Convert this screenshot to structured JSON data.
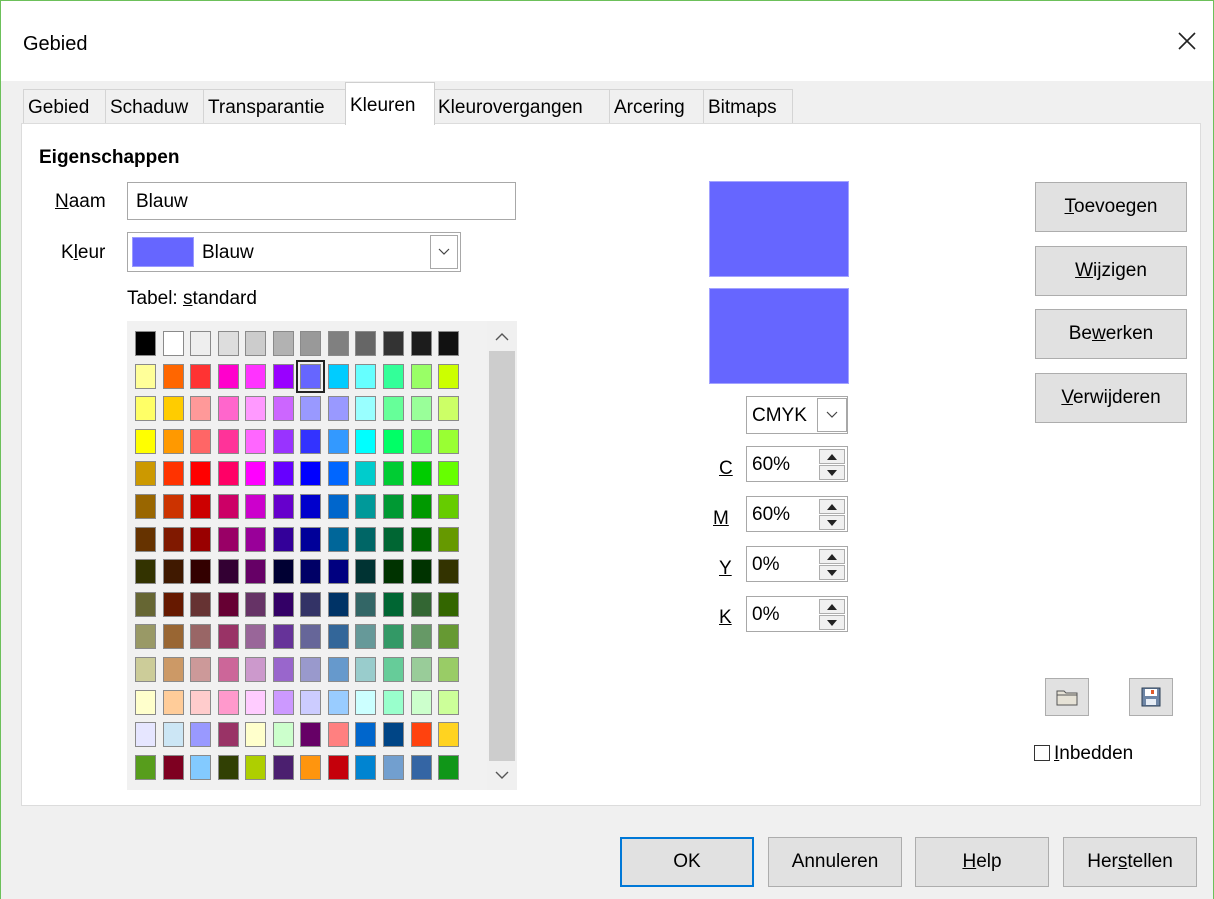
{
  "window": {
    "title": "Gebied"
  },
  "tabs": [
    {
      "label": "Gebied",
      "active": false
    },
    {
      "label": "Schaduw",
      "active": false
    },
    {
      "label": "Transparantie",
      "active": false
    },
    {
      "label": "Kleuren",
      "active": true
    },
    {
      "label": "Kleurovergangen",
      "active": false
    },
    {
      "label": "Arcering",
      "active": false
    },
    {
      "label": "Bitmaps",
      "active": false
    }
  ],
  "properties": {
    "heading": "Eigenschappen",
    "name_label_u": "N",
    "name_label_rest": "aam",
    "name_value": "Blauw",
    "color_label_pre": "K",
    "color_label_u": "l",
    "color_label_post": "eur",
    "color_value": "Blauw",
    "table_label_pre": "Tabel: ",
    "table_label_u": "s",
    "table_label_post": "tandard"
  },
  "palette": {
    "selected": "#6666ff",
    "rows": [
      [
        "#000000",
        "#ffffff",
        "#eeeeee",
        "#dddddd",
        "#cccccc",
        "#b2b2b2",
        "#999999",
        "#808080",
        "#666666",
        "#333333",
        "#1c1c1c",
        "#111111"
      ],
      [
        "#ffff99",
        "#ff6600",
        "#ff3333",
        "#ff00cc",
        "#ff33ff",
        "#9900ff",
        "#6666ff",
        "#00ccff",
        "#66ffff",
        "#33ff99",
        "#99ff66",
        "#ccff00"
      ],
      [
        "#ffff66",
        "#ffcc00",
        "#ff9999",
        "#ff66cc",
        "#ff99ff",
        "#cc66ff",
        "#9999ff",
        "#9999ff",
        "#99ffff",
        "#66ff99",
        "#99ff99",
        "#ccff66"
      ],
      [
        "#ffff00",
        "#ff9900",
        "#ff6666",
        "#ff3399",
        "#ff66ff",
        "#9933ff",
        "#3333ff",
        "#3399ff",
        "#00ffff",
        "#00ff66",
        "#66ff66",
        "#99ff33"
      ],
      [
        "#cc9900",
        "#ff3300",
        "#ff0000",
        "#ff0066",
        "#ff00ff",
        "#6600ff",
        "#0000ff",
        "#0066ff",
        "#00cccc",
        "#00cc33",
        "#00cc00",
        "#66ff00"
      ],
      [
        "#996600",
        "#cc3300",
        "#cc0000",
        "#cc0066",
        "#cc00cc",
        "#6600cc",
        "#0000cc",
        "#0066cc",
        "#009999",
        "#009933",
        "#009900",
        "#66cc00"
      ],
      [
        "#663300",
        "#801900",
        "#990000",
        "#990066",
        "#990099",
        "#330099",
        "#000099",
        "#006699",
        "#006666",
        "#006633",
        "#006600",
        "#669900"
      ],
      [
        "#333300",
        "#401900",
        "#330000",
        "#330033",
        "#660066",
        "#000033",
        "#000066",
        "#000080",
        "#003333",
        "#003300",
        "#003300",
        "#333300"
      ],
      [
        "#666633",
        "#661900",
        "#663333",
        "#660033",
        "#663366",
        "#330066",
        "#333366",
        "#003366",
        "#336666",
        "#006633",
        "#336633",
        "#336600"
      ],
      [
        "#999966",
        "#996633",
        "#996666",
        "#993366",
        "#996699",
        "#663399",
        "#666699",
        "#336699",
        "#669999",
        "#339966",
        "#669966",
        "#669933"
      ],
      [
        "#cccc99",
        "#cc9966",
        "#cc9999",
        "#cc6699",
        "#cc99cc",
        "#9966cc",
        "#9999cc",
        "#6699cc",
        "#99cccc",
        "#66cc99",
        "#99cc99",
        "#99cc66"
      ],
      [
        "#ffffcc",
        "#ffcc99",
        "#ffcccc",
        "#ff99cc",
        "#ffccff",
        "#cc99ff",
        "#ccccff",
        "#99ccff",
        "#ccffff",
        "#99ffcc",
        "#ccffcc",
        "#ccff99"
      ],
      [
        "#e6e6ff",
        "#cce6f5",
        "#9999ff",
        "#993366",
        "#ffffcc",
        "#ccffcc",
        "#660066",
        "#ff8080",
        "#0066cc",
        "#004586",
        "#ff420e",
        "#ffd320"
      ],
      [
        "#579d1c",
        "#7e0021",
        "#83caff",
        "#314004",
        "#aecf00",
        "#4b1f6f",
        "#ff950e",
        "#c5000b",
        "#0084d1",
        "#729fcf",
        "#3465a4",
        "#109618"
      ]
    ]
  },
  "preview": {
    "old_color": "#6666ff",
    "new_color": "#6666ff"
  },
  "color_model": {
    "selected": "CMYK"
  },
  "cmyk": [
    {
      "letter": "C",
      "value": "60%"
    },
    {
      "letter": "M",
      "value": "60%"
    },
    {
      "letter": "Y",
      "value": "0%"
    },
    {
      "letter": "K",
      "value": "0%"
    }
  ],
  "side_buttons": [
    {
      "u": "T",
      "rest": "oevoegen",
      "pre": ""
    },
    {
      "pre": "",
      "u": "W",
      "rest": "ijzigen"
    },
    {
      "pre": "Be",
      "u": "w",
      "rest": "erken"
    },
    {
      "pre": "",
      "u": "V",
      "rest": "erwijderen"
    }
  ],
  "embed": {
    "pre": "",
    "u": "I",
    "rest": "nbedden",
    "checked": false
  },
  "footer": {
    "ok": "OK",
    "cancel": "Annuleren",
    "help_u": "H",
    "help_rest": "elp",
    "reset_pre": "Her",
    "reset_u": "s",
    "reset_rest": "tellen"
  },
  "icons": {
    "close": "close-icon",
    "open": "folder-icon",
    "save": "save-icon",
    "dropdown": "chevron-down-icon",
    "scroll_up": "chevron-up-icon",
    "scroll_down": "chevron-down-icon"
  }
}
